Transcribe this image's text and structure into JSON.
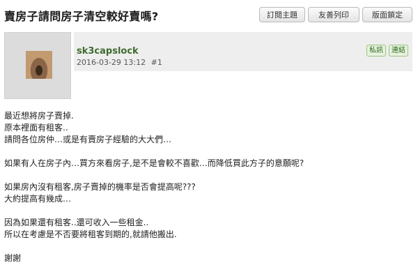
{
  "thread": {
    "title": "賣房子請問房子清空較好賣嗎?"
  },
  "toolbar": {
    "subscribe_label": "訂閱主題",
    "print_label": "友善列印",
    "lock_layout_label": "版面鎖定"
  },
  "post": {
    "username": "sk3capslock",
    "date": "2016-03-29 13:12",
    "floor": "#1",
    "pm_label": "私訊",
    "link_label": "連結",
    "body": {
      "l1": "最近想將房子賣掉.",
      "l2": "原本裡面有租客..",
      "l3": "請問各位房仲…或是有賣房子經驗的大大們…",
      "l4": "如果有人在房子內…買方來看房子,是不是會較不喜歡…而降低買此方子的意願呢?",
      "l5": "如果房內沒有租客,房子賣掉的機率是否會提高呢???",
      "l6": "大約提高有幾成…",
      "l7": "因為如果還有租客..還可收入一些租金..",
      "l8": "所以在考慮是不否要將租客到期的,就請他搬出.",
      "l9": "謝謝"
    }
  }
}
